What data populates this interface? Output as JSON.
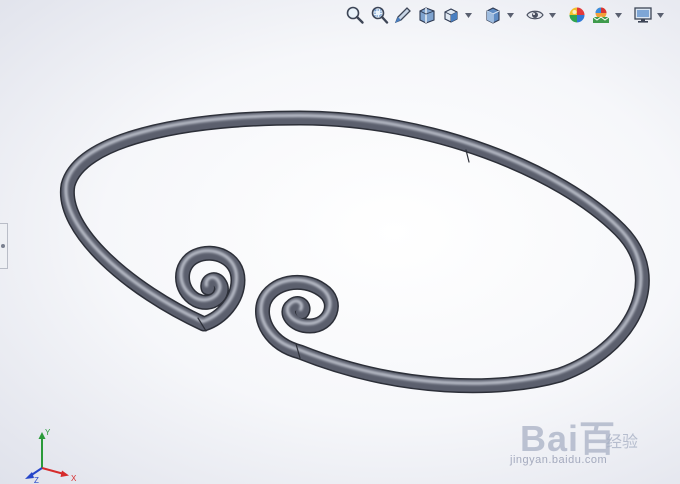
{
  "toolbar": {
    "buttons": [
      {
        "id": "zoom-to-fit",
        "icon": "magnifier-icon"
      },
      {
        "id": "zoom-to-area",
        "icon": "zoom-area-icon"
      },
      {
        "id": "previous-view",
        "icon": "pencil-view-icon"
      },
      {
        "id": "section-view",
        "icon": "section-view-icon"
      },
      {
        "id": "view-orientation",
        "icon": "view-orientation-icon"
      },
      {
        "id": "display-style",
        "icon": "cube-display-icon"
      },
      {
        "id": "hide-show-items",
        "icon": "eye-icon"
      },
      {
        "id": "edit-appearance",
        "icon": "appearance-ball-icon"
      },
      {
        "id": "apply-scene",
        "icon": "scene-icon"
      },
      {
        "id": "view-settings",
        "icon": "monitor-icon"
      }
    ]
  },
  "model": {
    "name": "spiral-bangle",
    "tube_color": "#5b5f6d",
    "tube_highlight": "#c3c7d2",
    "tube_shadow": "#2c2f38"
  },
  "triad": {
    "x_label": "X",
    "y_label": "Y",
    "z_label": "Z",
    "x_color": "#d62b2b",
    "y_color": "#2a9a3a",
    "z_color": "#2646c9"
  },
  "watermark": {
    "logo": "Bai百",
    "cn": "经验",
    "url": "jingyan.baidu.com"
  }
}
